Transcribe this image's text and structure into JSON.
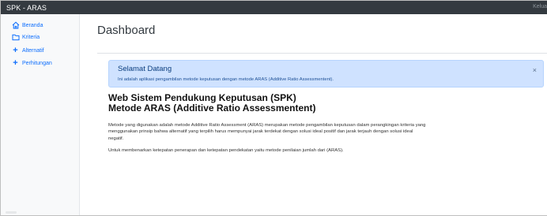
{
  "app": {
    "brand": "SPK - ARAS",
    "logout_label": "Kelua"
  },
  "sidebar": {
    "items": [
      {
        "label": "Beranda",
        "icon": "home-icon"
      },
      {
        "label": "Kriteria",
        "icon": "folder-icon"
      },
      {
        "label": "Alternatif",
        "icon": "plus-icon"
      },
      {
        "label": "Perhitungan",
        "icon": "plus-icon"
      }
    ]
  },
  "main": {
    "title": "Dashboard",
    "alert": {
      "title": "Selamat Datang",
      "text": "Ini adalah aplikasi pengambilan metode keputusan dengan metode ARAS (Additive Ratio Assessmentent).",
      "close": "×"
    },
    "heading_line1": "Web Sistem Pendukung Keputusan (SPK)",
    "heading_line2": "Metode ARAS (Additive Ratio Assessmentent)",
    "paragraph1_line1": "Metode yang digunakan adalah metode Additive Ratio Assessment (ARAS) merupakan metode pengambilan keputusan dalam perangkingan kriteria yang",
    "paragraph1_line2": "menggunakan prinsip bahwa alternatif yang terpilih harus mempunyai jarak terdekat dengan solusi ideal positif dan jarak terjauh dengan solusi ideal",
    "paragraph1_line3": "negatif.",
    "paragraph2": "Untuk membenarkan ketepatan penerapan dan ketepatan pendekatan yaitu metode penilaian jumlah dari (ARAS)."
  },
  "colors": {
    "topbar": "#343a40",
    "link": "#0d6efd",
    "alert_bg": "#cfe2ff"
  }
}
